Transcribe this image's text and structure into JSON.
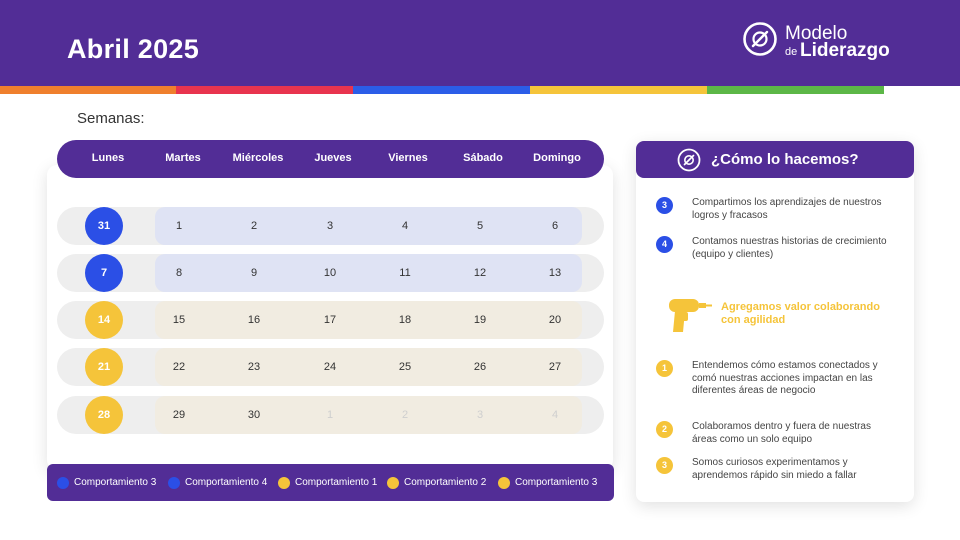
{
  "header": {
    "title": "Abril 2025"
  },
  "logo": {
    "line1": "Modelo",
    "line2_small": "de",
    "line2_large": "Liderazgo"
  },
  "colors": {
    "purple": "#522d96",
    "blue": "#2b4fe6",
    "yellow": "#f5c43a",
    "stripes": [
      "#ef7f2d",
      "#e8344e",
      "#2b5de8",
      "#f5c43a",
      "#5cb747"
    ]
  },
  "calendar": {
    "section_label": "Semanas:",
    "days": [
      "Lunes",
      "Martes",
      "Miércoles",
      "Jueves",
      "Viernes",
      "Sábado",
      "Domingo"
    ],
    "weeks": [
      {
        "label": "31",
        "behavior": "3",
        "days": [
          "1",
          "2",
          "3",
          "4",
          "5",
          "6"
        ],
        "faded_from": 6
      },
      {
        "label": "7",
        "behavior": "4",
        "days": [
          "8",
          "9",
          "10",
          "11",
          "12",
          "13"
        ],
        "faded_from": 6
      },
      {
        "label": "14",
        "behavior": "1",
        "days": [
          "15",
          "16",
          "17",
          "18",
          "19",
          "20"
        ],
        "faded_from": 6
      },
      {
        "label": "21",
        "behavior": "2",
        "days": [
          "22",
          "23",
          "24",
          "25",
          "26",
          "27"
        ],
        "faded_from": 6
      },
      {
        "label": "28",
        "behavior": "3",
        "days": [
          "29",
          "30",
          "1",
          "2",
          "3",
          "4"
        ],
        "faded_from": 2
      }
    ]
  },
  "legend": [
    {
      "label": "Comportamiento 3",
      "color": "#2b4fe6"
    },
    {
      "label": "Comportamiento 4",
      "color": "#2b4fe6"
    },
    {
      "label": "Comportamiento 1",
      "color": "#f5c43a"
    },
    {
      "label": "Comportamiento 2",
      "color": "#f5c43a"
    },
    {
      "label": "Comportamiento 3",
      "color": "#f5c43a"
    }
  ],
  "side": {
    "title": "¿Cómo lo hacemos?",
    "items_top": [
      {
        "num": "3",
        "text": "Compartimos los aprendizajes de nuestros logros y fracasos"
      },
      {
        "num": "4",
        "text": "Contamos nuestras historias de crecimiento (equipo y clientes)"
      }
    ],
    "agility": "Agregamos valor colaborando con agilidad",
    "items_bottom": [
      {
        "num": "1",
        "text": "Entendemos cómo estamos conectados y comó nuestras acciones impactan en las diferentes áreas de negocio"
      },
      {
        "num": "2",
        "text": "Colaboramos dentro y fuera de nuestras áreas como un solo equipo"
      },
      {
        "num": "3",
        "text": "Somos curiosos experimentamos y aprendemos rápido sin miedo a fallar"
      }
    ]
  }
}
